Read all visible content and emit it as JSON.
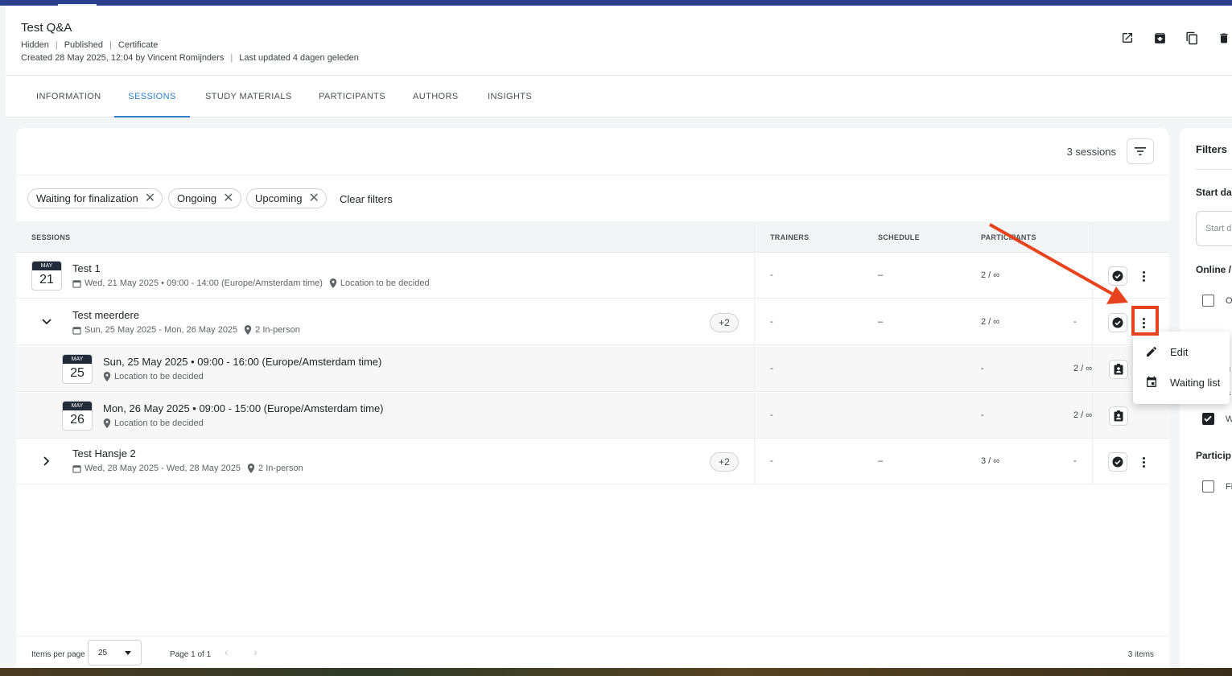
{
  "header": {
    "title": "Test Q&A",
    "status": [
      "Hidden",
      "Published",
      "Certificate"
    ],
    "created": "Created 28 May 2025, 12:04 by Vincent Romijnders",
    "updated": "Last updated 4 dagen geleden",
    "icons": [
      "open-external-icon",
      "archive-icon",
      "copy-icon",
      "delete-icon"
    ]
  },
  "tabs": [
    {
      "label": "INFORMATION"
    },
    {
      "label": "SESSIONS"
    },
    {
      "label": "STUDY MATERIALS"
    },
    {
      "label": "PARTICIPANTS"
    },
    {
      "label": "AUTHORS"
    },
    {
      "label": "INSIGHTS"
    }
  ],
  "active_tab": "SESSIONS",
  "sessions": {
    "count_label": "3 sessions",
    "chips": [
      {
        "label": "Waiting for finalization"
      },
      {
        "label": "Ongoing"
      },
      {
        "label": "Upcoming"
      }
    ],
    "clear_filters": "Clear filters",
    "columns": {
      "sessions": "SESSIONS",
      "trainers": "TRAINERS",
      "schedule": "SCHEDULE",
      "participants": "PARTICIPANTS"
    },
    "rows": [
      {
        "month": "MAY",
        "day": "21",
        "title": "Test 1",
        "date": "Wed, 21 May 2025 • 09:00 - 14:00 (Europe/Amsterdam time)",
        "location": "Location to be decided",
        "trainers": "-",
        "schedule": "–",
        "participants": "2 / ∞"
      },
      {
        "title": "Test meerdere",
        "date": "Sun, 25 May 2025 - Mon, 26 May 2025",
        "location": "2 In-person",
        "badge": "+2",
        "trainers": "-",
        "schedule": "–",
        "participants": "2 / ∞",
        "extra": "-"
      },
      {
        "month": "MAY",
        "day": "25",
        "title": "Sun, 25 May 2025 • 09:00 - 16:00 (Europe/Amsterdam time)",
        "location": "Location to be decided",
        "trainers": "-",
        "schedule": "-",
        "participants": "2 / ∞"
      },
      {
        "month": "MAY",
        "day": "26",
        "title": "Mon, 26 May 2025 • 09:00 - 15:00 (Europe/Amsterdam time)",
        "location": "Location to be decided",
        "trainers": "-",
        "schedule": "-",
        "participants": "2 / ∞"
      },
      {
        "title": "Test Hansje 2",
        "date": "Wed, 28 May 2025 - Wed, 28 May 2025",
        "location": "2 In-person",
        "badge": "+2",
        "trainers": "-",
        "schedule": "–",
        "participants": "3 / ∞",
        "extra": "-"
      }
    ],
    "footer": {
      "items_per_page_label": "Items per page",
      "items_per_page": "25",
      "page_info": "Page 1 of 1",
      "items_count": "3 items"
    }
  },
  "context_menu": {
    "items": [
      {
        "label": "Edit",
        "icon": "edit-icon"
      },
      {
        "label": "Waiting list",
        "icon": "calendar-icon"
      }
    ]
  },
  "filters_panel": {
    "title": "Filters",
    "start_date_heading": "Start da",
    "start_date_placeholder": "Start d",
    "online_heading": "Online /",
    "online_option": "O",
    "status_partial_1": "u",
    "status_partial_2": "a",
    "waiting_option": "W",
    "participants_heading": "Particip",
    "participants_option": "Fi"
  },
  "colors": {
    "accent": "#2f80c8",
    "topbar": "#2b3f8f",
    "annotation": "#e8431f"
  }
}
